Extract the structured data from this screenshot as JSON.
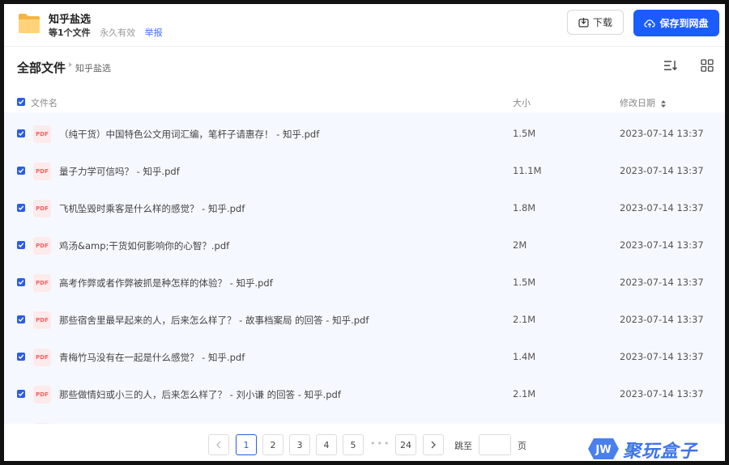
{
  "header": {
    "share_name": "知乎盐选",
    "file_count": "等1个文件",
    "validity": "永久有效",
    "report": "举报",
    "download_label": "下载",
    "save_label": "保存到网盘"
  },
  "breadcrumb": {
    "root": "全部文件",
    "current": "知乎盐选"
  },
  "table": {
    "columns": {
      "name": "文件名",
      "size": "大小",
      "modified": "修改日期"
    },
    "file_badge": "PDF",
    "rows": [
      {
        "name": "（纯干货）中国特色公文用词汇编，笔杆子请惠存！ - 知乎.pdf",
        "size": "1.5M",
        "date": "2023-07-14 13:37"
      },
      {
        "name": "量子力学可信吗？ - 知乎.pdf",
        "size": "11.1M",
        "date": "2023-07-14 13:37"
      },
      {
        "name": "飞机坠毁时乘客是什么样的感觉？ - 知乎.pdf",
        "size": "1.8M",
        "date": "2023-07-14 13:37"
      },
      {
        "name": "鸡汤&amp;干货如何影响你的心智？.pdf",
        "size": "2M",
        "date": "2023-07-14 13:37"
      },
      {
        "name": "高考作弊或者作弊被抓是种怎样的体验？ - 知乎.pdf",
        "size": "1.5M",
        "date": "2023-07-14 13:37"
      },
      {
        "name": "那些宿舍里最早起来的人，后来怎么样了？ - 故事档案局 的回答 - 知乎.pdf",
        "size": "2.1M",
        "date": "2023-07-14 13:37"
      },
      {
        "name": "青梅竹马没有在一起是什么感觉？ - 知乎.pdf",
        "size": "1.4M",
        "date": "2023-07-14 13:37"
      },
      {
        "name": "那些做情妇或小三的人，后来怎么样了？ - 刘小谦 的回答 - 知乎.pdf",
        "size": "2.1M",
        "date": "2023-07-14 13:37"
      }
    ]
  },
  "pagination": {
    "pages": [
      "1",
      "2",
      "3",
      "4",
      "5"
    ],
    "current": "1",
    "ellipsis": "•••",
    "last": "24",
    "jump_label": "跳至",
    "jump_value": "",
    "page_label": "页"
  },
  "watermark": {
    "badge": "JW",
    "text": "聚玩盒子"
  },
  "colors": {
    "primary": "#1a5cff",
    "link": "#3b6cff",
    "row_background": "#f6f8ff",
    "pdf_badge": "#f26262"
  }
}
